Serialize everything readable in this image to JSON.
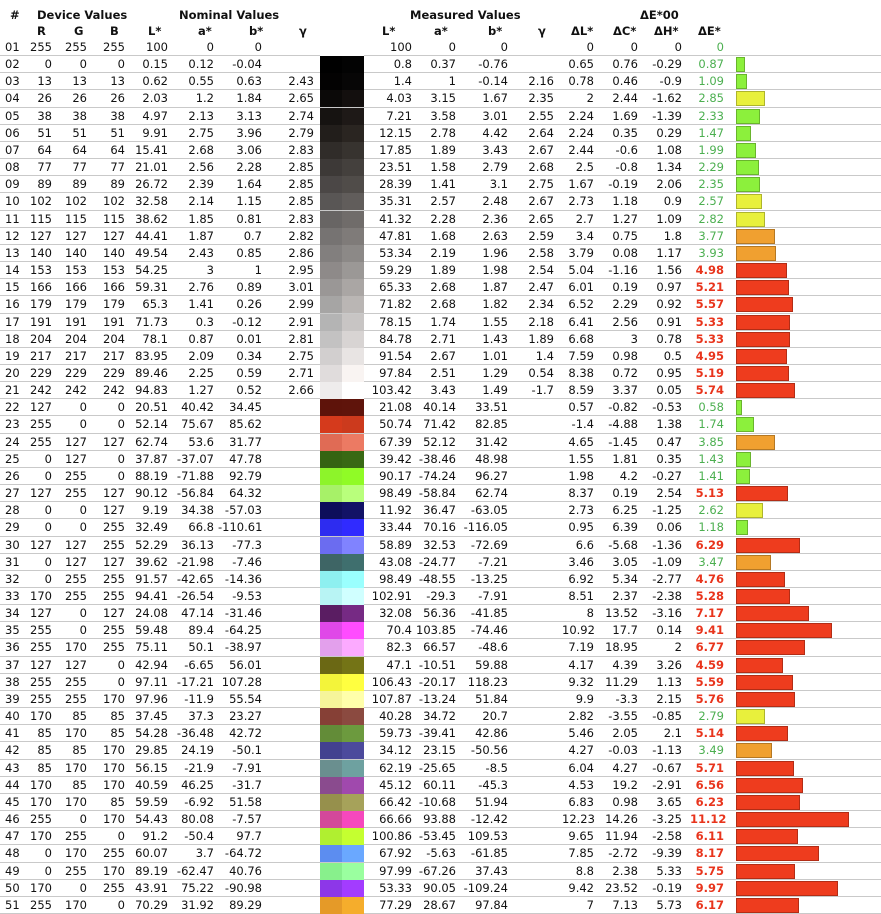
{
  "headers": {
    "index": "#",
    "device_group": "Device Values",
    "nominal_group": "Nominal Values",
    "measured_group": "Measured Values",
    "de_group": "ΔE*00",
    "r": "R",
    "g": "G",
    "b": "B",
    "nom_l": "L*",
    "nom_a": "a*",
    "nom_b": "b*",
    "nom_gamma": "γ",
    "meas_l": "L*",
    "meas_a": "a*",
    "meas_b": "b*",
    "meas_gamma": "γ",
    "dl": "ΔL*",
    "dc": "ΔC*",
    "dh": "ΔH*",
    "de": "ΔE*"
  },
  "colors": {
    "de_good": "#4caf50",
    "de_bad": "#e8341c",
    "bar_green": "#8cf03c",
    "bar_yellow": "#e8f03c",
    "bar_orange": "#f0a030",
    "bar_red": "#ee3c1e"
  },
  "rows": [
    {
      "id": "01",
      "r": "255",
      "g": "255",
      "b": "255",
      "nl": "100",
      "na": "0",
      "nb": "0",
      "ng": "",
      "ml": "100",
      "ma": "0",
      "mb": "0",
      "mg": "",
      "dl": "0",
      "dc": "0",
      "dh": "0",
      "de": "0",
      "sn": "#ffffff",
      "sm": "#ffffff"
    },
    {
      "id": "02",
      "r": "0",
      "g": "0",
      "b": "0",
      "nl": "0.15",
      "na": "0.12",
      "nb": "-0.04",
      "ng": "",
      "ml": "0.8",
      "ma": "0.37",
      "mb": "-0.76",
      "mg": "",
      "dl": "0.65",
      "dc": "0.76",
      "dh": "-0.29",
      "de": "0.87",
      "sn": "#000000",
      "sm": "#030303"
    },
    {
      "id": "03",
      "r": "13",
      "g": "13",
      "b": "13",
      "nl": "0.62",
      "na": "0.55",
      "nb": "0.63",
      "ng": "2.43",
      "ml": "1.4",
      "ma": "1",
      "mb": "-0.14",
      "mg": "2.16",
      "dl": "0.78",
      "dc": "0.46",
      "dh": "-0.9",
      "de": "1.09",
      "sn": "#030202",
      "sm": "#070606"
    },
    {
      "id": "04",
      "r": "26",
      "g": "26",
      "b": "26",
      "nl": "2.03",
      "na": "1.2",
      "nb": "1.84",
      "ng": "2.65",
      "ml": "4.03",
      "ma": "3.15",
      "mb": "1.67",
      "mg": "2.35",
      "dl": "2",
      "dc": "2.44",
      "dh": "-1.62",
      "de": "2.85",
      "sn": "#0b0908",
      "sm": "#130f0e"
    },
    {
      "id": "05",
      "r": "38",
      "g": "38",
      "b": "38",
      "nl": "4.97",
      "na": "2.13",
      "nb": "3.13",
      "ng": "2.74",
      "ml": "7.21",
      "ma": "3.58",
      "mb": "3.01",
      "mg": "2.55",
      "dl": "2.24",
      "dc": "1.69",
      "dh": "-1.39",
      "de": "2.33",
      "sn": "#161311",
      "sm": "#1e1917"
    },
    {
      "id": "06",
      "r": "51",
      "g": "51",
      "b": "51",
      "nl": "9.91",
      "na": "2.75",
      "nb": "3.96",
      "ng": "2.79",
      "ml": "12.15",
      "ma": "2.78",
      "mb": "4.42",
      "mg": "2.64",
      "dl": "2.24",
      "dc": "0.35",
      "dh": "0.29",
      "de": "1.47",
      "sn": "#221e1b",
      "sm": "#2a2521"
    },
    {
      "id": "07",
      "r": "64",
      "g": "64",
      "b": "64",
      "nl": "15.41",
      "na": "2.68",
      "nb": "3.06",
      "ng": "2.83",
      "ml": "17.85",
      "ma": "1.89",
      "mb": "3.43",
      "mg": "2.67",
      "dl": "2.44",
      "dc": "-0.6",
      "dh": "1.08",
      "de": "1.99",
      "sn": "#302c29",
      "sm": "#37332f"
    },
    {
      "id": "08",
      "r": "77",
      "g": "77",
      "b": "77",
      "nl": "21.01",
      "na": "2.56",
      "nb": "2.28",
      "ng": "2.85",
      "ml": "23.51",
      "ma": "1.58",
      "mb": "2.79",
      "mg": "2.68",
      "dl": "2.5",
      "dc": "-0.8",
      "dh": "1.34",
      "de": "2.29",
      "sn": "#3d3937",
      "sm": "#44403d"
    },
    {
      "id": "09",
      "r": "89",
      "g": "89",
      "b": "89",
      "nl": "26.72",
      "na": "2.39",
      "nb": "1.64",
      "ng": "2.85",
      "ml": "28.39",
      "ma": "1.41",
      "mb": "3.1",
      "mg": "2.75",
      "dl": "1.67",
      "dc": "-0.19",
      "dh": "2.06",
      "de": "2.35",
      "sn": "#4b4746",
      "sm": "#504c49"
    },
    {
      "id": "10",
      "r": "102",
      "g": "102",
      "b": "102",
      "nl": "32.58",
      "na": "2.14",
      "nb": "1.15",
      "ng": "2.85",
      "ml": "35.31",
      "ma": "2.57",
      "mb": "2.48",
      "mg": "2.67",
      "dl": "2.73",
      "dc": "1.18",
      "dh": "0.9",
      "de": "2.57",
      "sn": "#595655",
      "sm": "#615d5b"
    },
    {
      "id": "11",
      "r": "115",
      "g": "115",
      "b": "115",
      "nl": "38.62",
      "na": "1.85",
      "nb": "0.81",
      "ng": "2.83",
      "ml": "41.32",
      "ma": "2.28",
      "mb": "2.36",
      "mg": "2.65",
      "dl": "2.7",
      "dc": "1.27",
      "dh": "1.09",
      "de": "2.82",
      "sn": "#686564",
      "sm": "#706c6a"
    },
    {
      "id": "12",
      "r": "127",
      "g": "127",
      "b": "127",
      "nl": "44.41",
      "na": "1.87",
      "nb": "0.7",
      "ng": "2.82",
      "ml": "47.81",
      "ma": "1.68",
      "mb": "2.63",
      "mg": "2.59",
      "dl": "3.4",
      "dc": "0.75",
      "dh": "1.8",
      "de": "3.77",
      "sn": "#767372",
      "sm": "#7f7b79"
    },
    {
      "id": "13",
      "r": "140",
      "g": "140",
      "b": "140",
      "nl": "49.54",
      "na": "2.43",
      "nb": "0.85",
      "ng": "2.86",
      "ml": "53.34",
      "ma": "2.19",
      "mb": "1.96",
      "mg": "2.58",
      "dl": "3.79",
      "dc": "0.08",
      "dh": "1.17",
      "de": "3.93",
      "sn": "#827f7e",
      "sm": "#8c8987"
    },
    {
      "id": "14",
      "r": "153",
      "g": "153",
      "b": "153",
      "nl": "54.25",
      "na": "3",
      "nb": "1",
      "ng": "2.95",
      "ml": "59.29",
      "ma": "1.89",
      "mb": "1.98",
      "mg": "2.54",
      "dl": "5.04",
      "dc": "-1.16",
      "dh": "1.56",
      "de": "4.98",
      "sn": "#8e8a89",
      "sm": "#9b9896"
    },
    {
      "id": "15",
      "r": "166",
      "g": "166",
      "b": "166",
      "nl": "59.31",
      "na": "2.76",
      "nb": "0.89",
      "ng": "3.01",
      "ml": "65.33",
      "ma": "2.68",
      "mb": "1.87",
      "mg": "2.47",
      "dl": "6.01",
      "dc": "0.19",
      "dh": "0.97",
      "de": "5.21",
      "sn": "#9a9796",
      "sm": "#aaa6a4"
    },
    {
      "id": "16",
      "r": "179",
      "g": "179",
      "b": "179",
      "nl": "65.3",
      "na": "1.41",
      "nb": "0.26",
      "ng": "2.99",
      "ml": "71.82",
      "ma": "2.68",
      "mb": "1.82",
      "mg": "2.34",
      "dl": "6.52",
      "dc": "2.29",
      "dh": "0.92",
      "de": "5.57",
      "sn": "#a6a5a4",
      "sm": "#bab6b4"
    },
    {
      "id": "17",
      "r": "191",
      "g": "191",
      "b": "191",
      "nl": "71.73",
      "na": "0.3",
      "nb": "-0.12",
      "ng": "2.91",
      "ml": "78.15",
      "ma": "1.74",
      "mb": "1.55",
      "mg": "2.18",
      "dl": "6.41",
      "dc": "2.56",
      "dh": "0.91",
      "de": "5.33",
      "sn": "#b4b4b4",
      "sm": "#c8c5c4"
    },
    {
      "id": "18",
      "r": "204",
      "g": "204",
      "b": "204",
      "nl": "78.1",
      "na": "0.87",
      "nb": "0.01",
      "ng": "2.81",
      "ml": "84.78",
      "ma": "2.71",
      "mb": "1.43",
      "mg": "1.89",
      "dl": "6.68",
      "dc": "3",
      "dh": "0.78",
      "de": "5.33",
      "sn": "#c3c2c2",
      "sm": "#d8d4d3"
    },
    {
      "id": "19",
      "r": "217",
      "g": "217",
      "b": "217",
      "nl": "83.95",
      "na": "2.09",
      "nb": "0.34",
      "ng": "2.75",
      "ml": "91.54",
      "ma": "2.67",
      "mb": "1.01",
      "mg": "1.4",
      "dl": "7.59",
      "dc": "0.98",
      "dh": "0.5",
      "de": "4.95",
      "sn": "#d2cfcf",
      "sm": "#e8e4e3"
    },
    {
      "id": "20",
      "r": "229",
      "g": "229",
      "b": "229",
      "nl": "89.46",
      "na": "2.25",
      "nb": "0.59",
      "ng": "2.71",
      "ml": "97.84",
      "ma": "2.51",
      "mb": "1.29",
      "mg": "0.54",
      "dl": "8.38",
      "dc": "0.72",
      "dh": "0.95",
      "de": "5.19",
      "sn": "#e0dcdc",
      "sm": "#f9f4f2"
    },
    {
      "id": "21",
      "r": "242",
      "g": "242",
      "b": "242",
      "nl": "94.83",
      "na": "1.27",
      "nb": "0.52",
      "ng": "2.66",
      "ml": "103.42",
      "ma": "3.43",
      "mb": "1.49",
      "mg": "-1.7",
      "dl": "8.59",
      "dc": "3.37",
      "dh": "0.05",
      "de": "5.74",
      "sn": "#eeecec",
      "sm": "#ffffff"
    },
    {
      "id": "22",
      "r": "127",
      "g": "0",
      "b": "0",
      "nl": "20.51",
      "na": "40.42",
      "nb": "34.45",
      "ng": "",
      "ml": "21.08",
      "ma": "40.14",
      "mb": "33.51",
      "mg": "",
      "dl": "0.57",
      "dc": "-0.82",
      "dh": "-0.53",
      "de": "0.58",
      "sn": "#5e130a",
      "sm": "#5f140b"
    },
    {
      "id": "23",
      "r": "255",
      "g": "0",
      "b": "0",
      "nl": "52.14",
      "na": "75.67",
      "nb": "85.62",
      "ng": "",
      "ml": "50.74",
      "ma": "71.42",
      "mb": "82.85",
      "mg": "",
      "dl": "-1.4",
      "dc": "-4.88",
      "dh": "1.38",
      "de": "1.74",
      "sn": "#d53a1c",
      "sm": "#cc3a1d"
    },
    {
      "id": "24",
      "r": "255",
      "g": "127",
      "b": "127",
      "nl": "62.74",
      "na": "53.6",
      "nb": "31.77",
      "ng": "",
      "ml": "67.39",
      "ma": "52.12",
      "mb": "31.42",
      "mg": "",
      "dl": "4.65",
      "dc": "-1.45",
      "dh": "0.47",
      "de": "3.85",
      "sn": "#e06b55",
      "sm": "#ec7a63"
    },
    {
      "id": "25",
      "r": "0",
      "g": "127",
      "b": "0",
      "nl": "37.87",
      "na": "-37.07",
      "nb": "47.78",
      "ng": "",
      "ml": "39.42",
      "ma": "-38.46",
      "mb": "48.98",
      "mg": "",
      "dl": "1.55",
      "dc": "1.81",
      "dh": "0.35",
      "de": "1.43",
      "sn": "#356412",
      "sm": "#386914"
    },
    {
      "id": "26",
      "r": "0",
      "g": "255",
      "b": "0",
      "nl": "88.19",
      "na": "-71.88",
      "nb": "92.79",
      "ng": "",
      "ml": "90.17",
      "ma": "-74.24",
      "mb": "96.27",
      "mg": "",
      "dl": "1.98",
      "dc": "4.2",
      "dh": "-0.27",
      "de": "1.41",
      "sn": "#8df42a",
      "sm": "#90fb26"
    },
    {
      "id": "27",
      "r": "127",
      "g": "255",
      "b": "127",
      "nl": "90.12",
      "na": "-56.84",
      "nb": "64.32",
      "ng": "",
      "ml": "98.49",
      "ma": "-58.84",
      "mb": "62.74",
      "mg": "",
      "dl": "8.37",
      "dc": "0.19",
      "dh": "2.54",
      "de": "5.13",
      "sn": "#a7f168",
      "sm": "#b9ff7c"
    },
    {
      "id": "28",
      "r": "0",
      "g": "0",
      "b": "127",
      "nl": "9.19",
      "na": "34.38",
      "nb": "-57.03",
      "ng": "",
      "ml": "11.92",
      "ma": "36.47",
      "mb": "-63.05",
      "mg": "",
      "dl": "2.73",
      "dc": "6.25",
      "dh": "-1.25",
      "de": "2.62",
      "sn": "#0d0e5a",
      "sm": "#121266"
    },
    {
      "id": "29",
      "r": "0",
      "g": "0",
      "b": "255",
      "nl": "32.49",
      "na": "66.8",
      "nb": "-110.61",
      "ng": "",
      "ml": "33.44",
      "ma": "70.16",
      "mb": "-116.05",
      "mg": "",
      "dl": "0.95",
      "dc": "6.39",
      "dh": "0.06",
      "de": "1.18",
      "sn": "#2d2cf0",
      "sm": "#302bff"
    },
    {
      "id": "30",
      "r": "127",
      "g": "127",
      "b": "255",
      "nl": "52.29",
      "na": "36.13",
      "nb": "-77.3",
      "ng": "",
      "ml": "58.89",
      "ma": "32.53",
      "mb": "-72.69",
      "mg": "",
      "dl": "6.6",
      "dc": "-5.68",
      "dh": "-1.36",
      "de": "6.29",
      "sn": "#6b6cf0",
      "sm": "#8083ff"
    },
    {
      "id": "31",
      "r": "0",
      "g": "127",
      "b": "127",
      "nl": "39.62",
      "na": "-21.98",
      "nb": "-7.46",
      "ng": "",
      "ml": "43.08",
      "ma": "-24.77",
      "mb": "-7.21",
      "mg": "",
      "dl": "3.46",
      "dc": "3.05",
      "dh": "-1.09",
      "de": "3.47",
      "sn": "#3e6565",
      "sm": "#3f6f6e"
    },
    {
      "id": "32",
      "r": "0",
      "g": "255",
      "b": "255",
      "nl": "91.57",
      "na": "-42.65",
      "nb": "-14.36",
      "ng": "",
      "ml": "98.49",
      "ma": "-48.55",
      "mb": "-13.25",
      "mg": "",
      "dl": "6.92",
      "dc": "5.34",
      "dh": "-2.77",
      "de": "4.76",
      "sn": "#8ef0f0",
      "sm": "#9afffe"
    },
    {
      "id": "33",
      "r": "170",
      "g": "255",
      "b": "255",
      "nl": "94.41",
      "na": "-26.54",
      "nb": "-9.53",
      "ng": "",
      "ml": "102.91",
      "ma": "-29.3",
      "mb": "-7.91",
      "mg": "",
      "dl": "8.51",
      "dc": "2.37",
      "dh": "-2.38",
      "de": "5.28",
      "sn": "#b8f4f4",
      "sm": "#d0ffff"
    },
    {
      "id": "34",
      "r": "127",
      "g": "0",
      "b": "127",
      "nl": "24.08",
      "na": "47.14",
      "nb": "-31.46",
      "ng": "",
      "ml": "32.08",
      "ma": "56.36",
      "mb": "-41.85",
      "mg": "",
      "dl": "8",
      "dc": "13.52",
      "dh": "-3.16",
      "de": "7.17",
      "sn": "#5a1d62",
      "sm": "#762a84"
    },
    {
      "id": "35",
      "r": "255",
      "g": "0",
      "b": "255",
      "nl": "59.48",
      "na": "89.4",
      "nb": "-64.25",
      "ng": "",
      "ml": "70.4",
      "ma": "103.85",
      "mb": "-74.46",
      "mg": "",
      "dl": "10.92",
      "dc": "17.7",
      "dh": "0.14",
      "de": "9.41",
      "sn": "#e048e8",
      "sm": "#ff4cff"
    },
    {
      "id": "36",
      "r": "255",
      "g": "170",
      "b": "255",
      "nl": "75.11",
      "na": "50.1",
      "nb": "-38.97",
      "ng": "",
      "ml": "82.3",
      "ma": "66.57",
      "mb": "-48.6",
      "mg": "",
      "dl": "7.19",
      "dc": "18.95",
      "dh": "2",
      "de": "6.77",
      "sn": "#e3a0ec",
      "sm": "#fcaaff"
    },
    {
      "id": "37",
      "r": "127",
      "g": "127",
      "b": "0",
      "nl": "42.94",
      "na": "-6.65",
      "nb": "56.01",
      "ng": "",
      "ml": "47.1",
      "ma": "-10.51",
      "mb": "59.88",
      "mg": "",
      "dl": "4.17",
      "dc": "4.39",
      "dh": "3.26",
      "de": "4.59",
      "sn": "#6b6814",
      "sm": "#747416"
    },
    {
      "id": "38",
      "r": "255",
      "g": "255",
      "b": "0",
      "nl": "97.11",
      "na": "-17.21",
      "nb": "107.28",
      "ng": "",
      "ml": "106.43",
      "ma": "-20.17",
      "mb": "118.23",
      "mg": "",
      "dl": "9.32",
      "dc": "11.29",
      "dh": "1.13",
      "de": "5.59",
      "sn": "#f3f43a",
      "sm": "#ffff40"
    },
    {
      "id": "39",
      "r": "255",
      "g": "255",
      "b": "170",
      "nl": "97.96",
      "na": "-11.9",
      "nb": "55.54",
      "ng": "",
      "ml": "107.87",
      "ma": "-13.24",
      "mb": "51.84",
      "mg": "",
      "dl": "9.9",
      "dc": "-3.3",
      "dh": "2.15",
      "de": "5.76",
      "sn": "#f6f59a",
      "sm": "#ffffaa"
    },
    {
      "id": "40",
      "r": "170",
      "g": "85",
      "b": "85",
      "nl": "37.45",
      "na": "37.3",
      "nb": "23.27",
      "ng": "",
      "ml": "40.28",
      "ma": "34.72",
      "mb": "20.7",
      "mg": "",
      "dl": "2.82",
      "dc": "-3.55",
      "dh": "-0.85",
      "de": "2.79",
      "sn": "#864036",
      "sm": "#8b4a40"
    },
    {
      "id": "41",
      "r": "85",
      "g": "170",
      "b": "85",
      "nl": "54.28",
      "na": "-36.48",
      "nb": "42.72",
      "ng": "",
      "ml": "59.73",
      "ma": "-39.41",
      "mb": "42.86",
      "mg": "",
      "dl": "5.46",
      "dc": "2.05",
      "dh": "2.1",
      "de": "5.14",
      "sn": "#638c38",
      "sm": "#6c9a3e"
    },
    {
      "id": "42",
      "r": "85",
      "g": "85",
      "b": "170",
      "nl": "29.85",
      "na": "24.19",
      "nb": "-50.1",
      "ng": "",
      "ml": "34.12",
      "ma": "23.15",
      "mb": "-50.56",
      "mg": "",
      "dl": "4.27",
      "dc": "-0.03",
      "dh": "-1.13",
      "de": "3.49",
      "sn": "#43418f",
      "sm": "#4c4a9c"
    },
    {
      "id": "43",
      "r": "85",
      "g": "170",
      "b": "170",
      "nl": "56.15",
      "na": "-21.9",
      "nb": "-7.91",
      "ng": "",
      "ml": "62.19",
      "ma": "-25.65",
      "mb": "-8.5",
      "mg": "",
      "dl": "6.04",
      "dc": "4.27",
      "dh": "-0.67",
      "de": "5.71",
      "sn": "#6a8f8f",
      "sm": "#6ea1a0"
    },
    {
      "id": "44",
      "r": "170",
      "g": "85",
      "b": "170",
      "nl": "40.59",
      "na": "46.25",
      "nb": "-31.7",
      "ng": "",
      "ml": "45.12",
      "ma": "60.11",
      "mb": "-45.3",
      "mg": "",
      "dl": "4.53",
      "dc": "19.2",
      "dh": "-2.91",
      "de": "6.56",
      "sn": "#8a4b8e",
      "sm": "#a049ad"
    },
    {
      "id": "45",
      "r": "170",
      "g": "170",
      "b": "85",
      "nl": "59.59",
      "na": "-6.92",
      "nb": "51.58",
      "ng": "",
      "ml": "66.42",
      "ma": "-10.68",
      "mb": "51.94",
      "mg": "",
      "dl": "6.83",
      "dc": "0.98",
      "dh": "3.65",
      "de": "6.23",
      "sn": "#96904c",
      "sm": "#a6a25a"
    },
    {
      "id": "46",
      "r": "255",
      "g": "0",
      "b": "170",
      "nl": "54.43",
      "na": "80.08",
      "nb": "-7.57",
      "ng": "",
      "ml": "66.66",
      "ma": "93.88",
      "mb": "-12.42",
      "mg": "",
      "dl": "12.23",
      "dc": "14.26",
      "dh": "-3.25",
      "de": "11.12",
      "sn": "#d3489a",
      "sm": "#f648bd"
    },
    {
      "id": "47",
      "r": "170",
      "g": "255",
      "b": "0",
      "nl": "91.2",
      "na": "-50.4",
      "nb": "97.7",
      "ng": "",
      "ml": "100.86",
      "ma": "-53.45",
      "mb": "109.53",
      "mg": "",
      "dl": "9.65",
      "dc": "11.94",
      "dh": "-2.58",
      "de": "6.11",
      "sn": "#b0ef30",
      "sm": "#c5ff30"
    },
    {
      "id": "48",
      "r": "0",
      "g": "170",
      "b": "255",
      "nl": "60.07",
      "na": "3.7",
      "nb": "-64.72",
      "ng": "",
      "ml": "67.92",
      "ma": "-5.63",
      "mb": "-61.85",
      "mg": "",
      "dl": "7.85",
      "dc": "-2.72",
      "dh": "-9.39",
      "de": "8.17",
      "sn": "#5c8df0",
      "sm": "#6aa8ff"
    },
    {
      "id": "49",
      "r": "0",
      "g": "255",
      "b": "170",
      "nl": "89.19",
      "na": "-62.47",
      "nb": "40.76",
      "ng": "",
      "ml": "97.99",
      "ma": "-67.26",
      "mb": "37.43",
      "mg": "",
      "dl": "8.8",
      "dc": "2.38",
      "dh": "5.33",
      "de": "5.75",
      "sn": "#88f08c",
      "sm": "#9aff9f"
    },
    {
      "id": "50",
      "r": "170",
      "g": "0",
      "b": "255",
      "nl": "43.91",
      "na": "75.22",
      "nb": "-90.98",
      "ng": "",
      "ml": "53.33",
      "ma": "90.05",
      "mb": "-109.24",
      "mg": "",
      "dl": "9.42",
      "dc": "23.52",
      "dh": "-0.19",
      "de": "9.97",
      "sn": "#8d37e8",
      "sm": "#a33cff"
    },
    {
      "id": "51",
      "r": "255",
      "g": "170",
      "b": "0",
      "nl": "70.29",
      "na": "31.92",
      "nb": "89.29",
      "ng": "",
      "ml": "77.29",
      "ma": "28.67",
      "mb": "97.84",
      "mg": "",
      "dl": "7",
      "dc": "7.13",
      "dh": "5.73",
      "de": "6.17",
      "sn": "#e59a28",
      "sm": "#f5ad2c"
    }
  ]
}
